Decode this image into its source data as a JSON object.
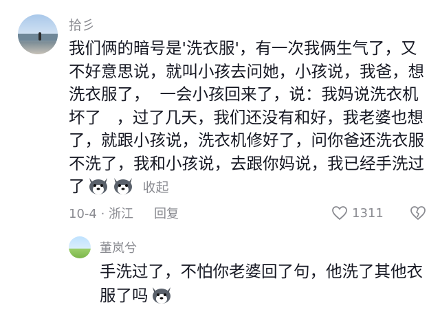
{
  "comment": {
    "username": "拾彡",
    "text": "我们俩的暗号是'洗衣服'，有一次我俩生气了，又不好意思说，就叫小孩去问她，小孩说，我爸，想洗衣服了，  一会小孩回来了，说：我妈说洗衣机坏了   ，过了几天，我们还没有和好，我老婆也想了，就跟小孩说，洗衣机修好了，问你爸还洗衣服不洗了，我和小孩说，去跟你妈说，我已经手洗过了",
    "emojis": [
      "husky-emoji",
      "husky-emoji"
    ],
    "collapse_label": "收起",
    "date_location": "10-4 · 浙江",
    "reply_label": "回复",
    "like_count": "1311"
  },
  "reply": {
    "username": "董岚兮",
    "text": "手洗过了，不怕你老婆回了句，他洗了其他衣服了吗",
    "emoji": "husky-emoji"
  },
  "colors": {
    "text_primary": "#161823",
    "text_secondary": "#8a8b91",
    "background": "#ffffff"
  }
}
